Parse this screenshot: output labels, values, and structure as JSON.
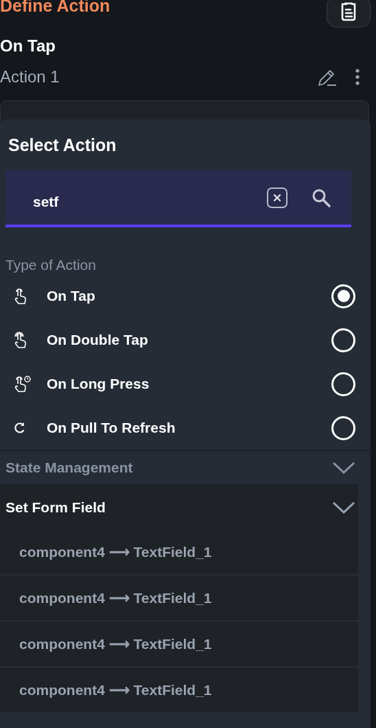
{
  "header": {
    "title": "Define Action"
  },
  "trigger": {
    "title": "On Tap",
    "action_label": "Action 1"
  },
  "dialog": {
    "title": "Select Action",
    "search": {
      "value": "setf"
    },
    "type_section": {
      "label": "Type of Action",
      "options": [
        {
          "label": "On Tap",
          "kind": "tap",
          "selected": true
        },
        {
          "label": "On Double Tap",
          "kind": "double-tap",
          "selected": false
        },
        {
          "label": "On Long Press",
          "kind": "long-press",
          "selected": false
        },
        {
          "label": "On Pull To Refresh",
          "kind": "refresh",
          "selected": false
        }
      ]
    },
    "categories": [
      {
        "label": "State Management",
        "expanded": false
      },
      {
        "label": "Set Form Field",
        "expanded": true,
        "items": [
          {
            "label": "component4 ⟶ TextField_1"
          },
          {
            "label": "component4 ⟶ TextField_1"
          },
          {
            "label": "component4 ⟶ TextField_1"
          },
          {
            "label": "component4 ⟶ TextField_1"
          }
        ]
      }
    ]
  }
}
